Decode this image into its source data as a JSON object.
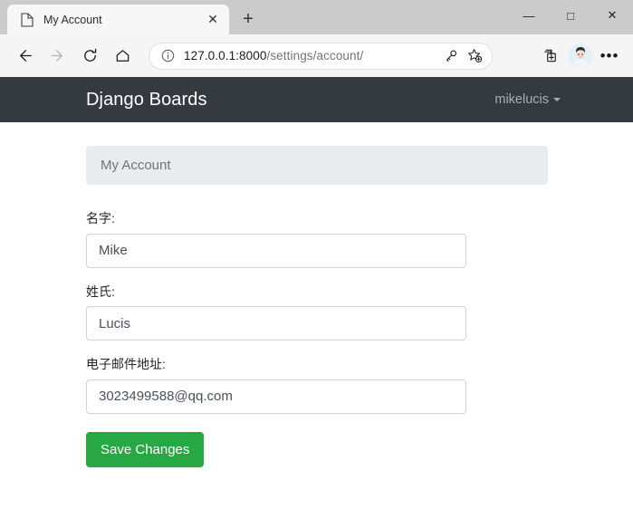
{
  "browser": {
    "tab": {
      "title": "My Account",
      "favicon": "page-icon",
      "close_label": "✕"
    },
    "new_tab_label": "+",
    "window_controls": {
      "minimize": "—",
      "maximize": "□",
      "close": "✕"
    },
    "toolbar": {
      "back": "←",
      "forward": "→",
      "reload": "reload-icon",
      "home": "home-icon",
      "url_host": "127.0.0.1:8000",
      "url_path": "/settings/account/",
      "url_full": "127.0.0.1:8000/settings/account/",
      "info_icon": "ⓘ",
      "key_icon": "key-icon",
      "favorite_icon": "star-add-icon",
      "collections_icon": "collections-icon",
      "profile_icon": "profile-avatar",
      "more_label": "•••"
    }
  },
  "navbar": {
    "brand": "Django Boards",
    "username": "mikelucis",
    "background": "#343a40"
  },
  "breadcrumb": {
    "label": "My Account",
    "background": "#e9ecef"
  },
  "form": {
    "fields": [
      {
        "label": "名字:",
        "value": "Mike",
        "name": "first-name"
      },
      {
        "label": "姓氏:",
        "value": "Lucis",
        "name": "last-name"
      },
      {
        "label": "电子邮件地址:",
        "value": "3023499588@qq.com",
        "name": "email"
      }
    ],
    "submit_label": "Save Changes",
    "submit_color": "#28a745"
  }
}
